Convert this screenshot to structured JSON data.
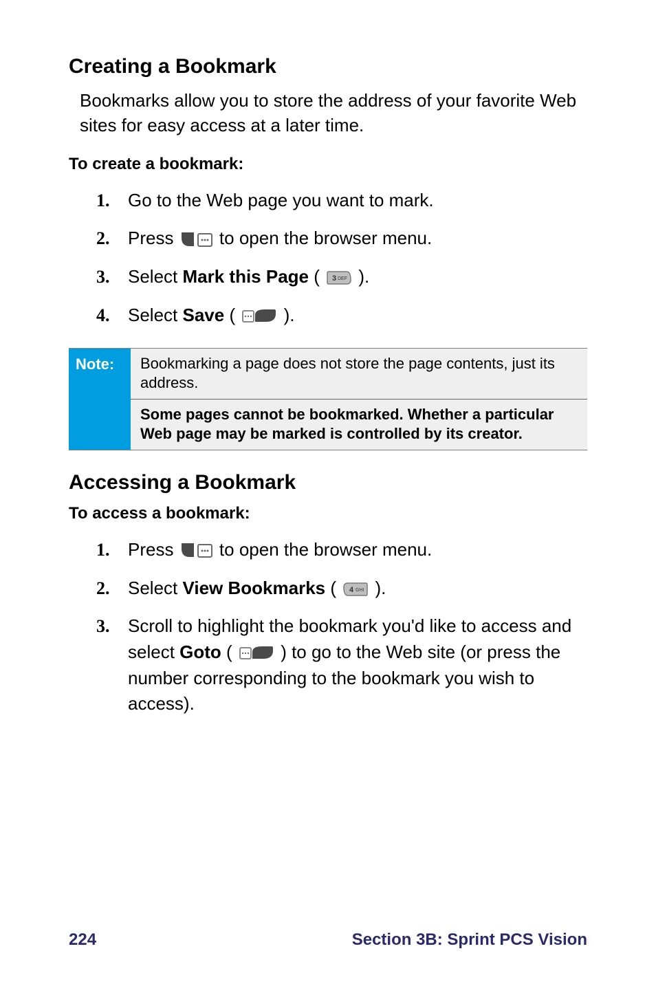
{
  "section_creating": {
    "heading": "Creating a Bookmark",
    "intro": "Bookmarks allow you to store the address of your favorite Web sites for easy access at a later time.",
    "subhead": "To create a bookmark:",
    "steps": [
      {
        "num": "1.",
        "pre": "Go to the Web page you want to mark."
      },
      {
        "num": "2.",
        "pre": "Press ",
        "post": " to open the browser menu."
      },
      {
        "num": "3.",
        "pre": "Select ",
        "bold": "Mark this Page",
        "post_open": " (",
        "post_close": ")."
      },
      {
        "num": "4.",
        "pre": "Select ",
        "bold": "Save",
        "post_open": " (",
        "post_close": ")."
      }
    ]
  },
  "note": {
    "label": "Note:",
    "line1": "Bookmarking a page does not store the page contents, just its address.",
    "line2": "Some pages cannot be bookmarked. Whether a particular Web page may be marked is controlled by its creator."
  },
  "section_accessing": {
    "heading": "Accessing a Bookmark",
    "subhead": "To access a bookmark:",
    "steps": [
      {
        "num": "1.",
        "pre": "Press ",
        "post": " to open the browser menu."
      },
      {
        "num": "2.",
        "pre": "Select ",
        "bold": "View Bookmarks",
        "post_open": " (",
        "post_close": ")."
      },
      {
        "num": "3.",
        "pre": "Scroll to highlight the bookmark you'd like to access and select ",
        "bold": "Goto",
        "post_open": " (",
        "post_close": ") to go to the Web site (or press the number corresponding to the bookmark you wish to access)."
      }
    ]
  },
  "footer": {
    "page": "224",
    "section": "Section 3B: Sprint PCS Vision"
  }
}
